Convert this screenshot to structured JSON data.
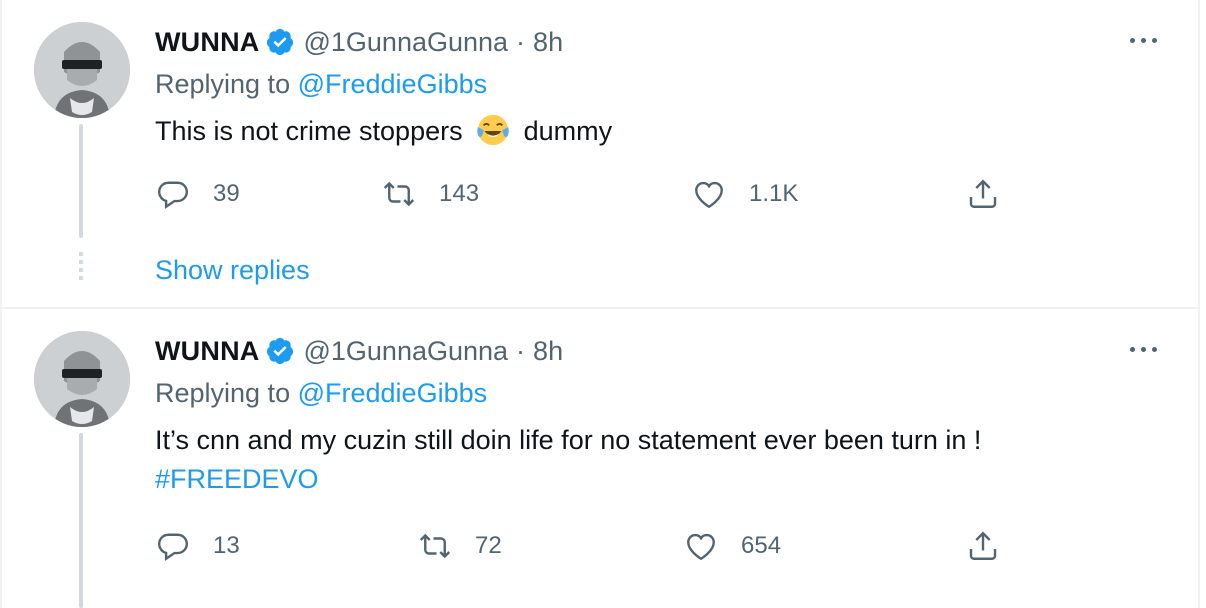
{
  "tweets": [
    {
      "name": "WUNNA",
      "handle": "@1GunnaGunna",
      "separator": "·",
      "time": "8h",
      "replying_prefix": "Replying to",
      "replying_to": "@FreddieGibbs",
      "text_before_emoji": "This is not crime stoppers",
      "emoji": "face-with-tears-of-joy",
      "text_after_emoji": "dummy",
      "replies": "39",
      "retweets": "143",
      "likes": "1.1K",
      "show_replies": "Show replies"
    },
    {
      "name": "WUNNA",
      "handle": "@1GunnaGunna",
      "separator": "·",
      "time": "8h",
      "replying_prefix": "Replying to",
      "replying_to": "@FreddieGibbs",
      "text_line1": "It’s cnn and my cuzin still doin life for no statement ever been turn in !",
      "hashtag": "#FREEDEVO",
      "replies": "13",
      "retweets": "72",
      "likes": "654"
    }
  ],
  "colors": {
    "accent": "#1d9bf0",
    "secondary_text": "#536471",
    "divider": "#eff3f4"
  }
}
